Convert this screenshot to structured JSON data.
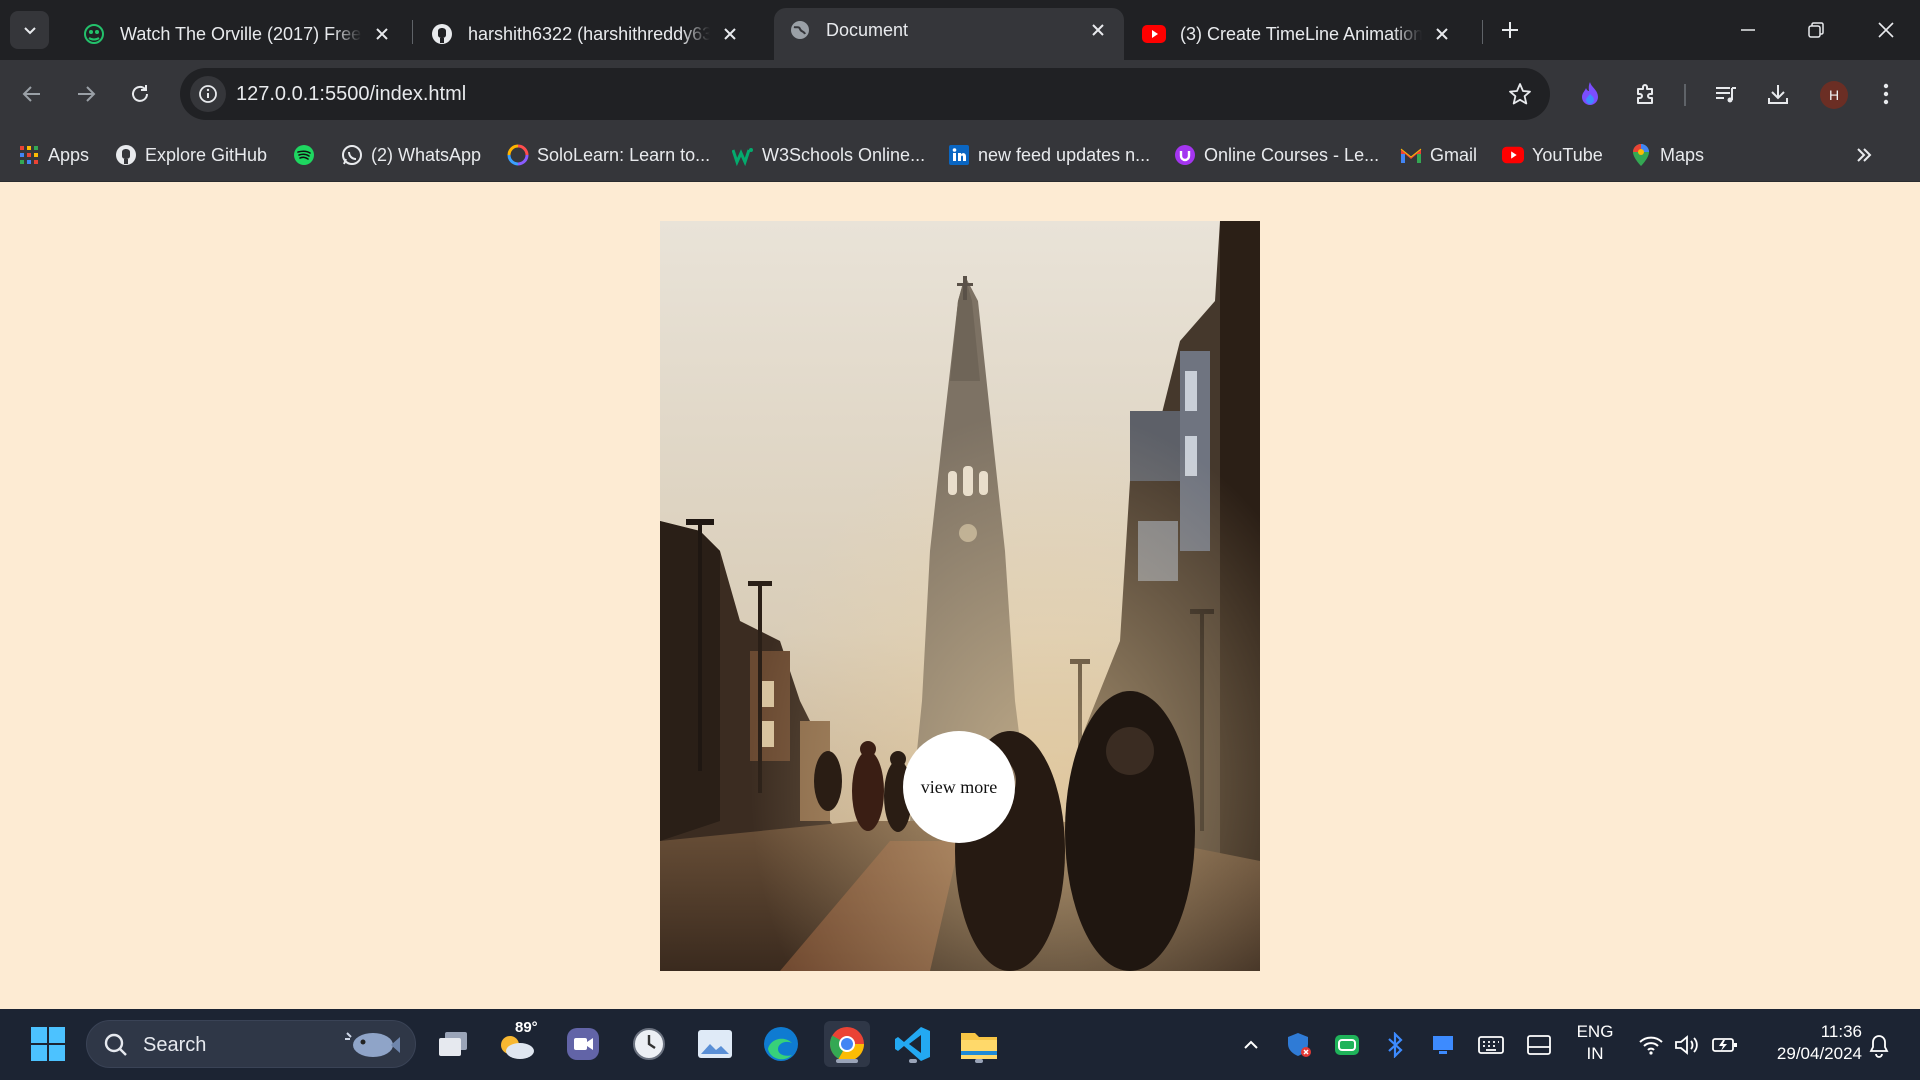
{
  "browser": {
    "tabs": [
      {
        "title": "Watch The Orville (2017) Free |",
        "favicon": "green-film-icon",
        "active": false
      },
      {
        "title": "harshith6322 (harshithreddy6322)",
        "favicon": "github-icon",
        "active": false
      },
      {
        "title": "Document",
        "favicon": "globe-icon",
        "active": true
      },
      {
        "title": "(3) Create TimeLine Animation |",
        "favicon": "youtube-icon",
        "active": false
      }
    ],
    "address_bar": {
      "url": "127.0.0.1:5500/index.html"
    },
    "profile_initial": "H",
    "bookmarks": [
      {
        "label": "Apps",
        "icon": "apps-grid-icon"
      },
      {
        "label": "Explore GitHub",
        "icon": "github-icon"
      },
      {
        "label": "",
        "icon": "spotify-icon"
      },
      {
        "label": "(2) WhatsApp",
        "icon": "whatsapp-icon"
      },
      {
        "label": "SoloLearn: Learn to...",
        "icon": "sololearn-icon"
      },
      {
        "label": "W3Schools Online...",
        "icon": "w3schools-icon"
      },
      {
        "label": "new feed updates n...",
        "icon": "linkedin-icon"
      },
      {
        "label": "Online Courses - Le...",
        "icon": "udemy-icon"
      },
      {
        "label": "Gmail",
        "icon": "gmail-icon"
      },
      {
        "label": "YouTube",
        "icon": "youtube-icon"
      },
      {
        "label": "Maps",
        "icon": "maps-icon"
      }
    ]
  },
  "page": {
    "background": "#fdebd3",
    "hero_image": "church-street-photo",
    "cta_label": "view more"
  },
  "taskbar": {
    "search_label": "Search",
    "weather_temp": "89°",
    "language": {
      "line1": "ENG",
      "line2": "IN"
    },
    "time": "11:36",
    "date": "29/04/2024"
  }
}
